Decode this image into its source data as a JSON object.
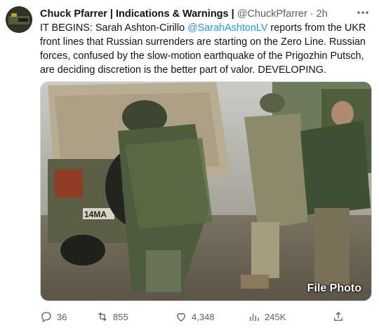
{
  "tweet": {
    "display_name": "Chuck Pfarrer | Indications & Warnings |",
    "handle": "@ChuckPfarrer",
    "separator": "·",
    "time": "2h",
    "text_prefix": "IT BEGINS: Sarah Ashton-Cirillo ",
    "mention": "@SarahAshtonLV",
    "text_suffix": " reports from the UKR front lines that Russian surrenders are starting on the Zero Line. Russian forces, confused by the slow-motion earthquake of the Prigozhin Putsch, are deciding discretion is the better part of valor.  DEVELOPING.",
    "media_caption": "File Photo",
    "vehicle_plate": "14МА"
  },
  "actions": {
    "replies": "36",
    "retweets": "855",
    "likes": "4,348",
    "views": "245K"
  },
  "icons": [
    "avatar",
    "more-icon",
    "reply-icon",
    "retweet-icon",
    "like-icon",
    "views-icon",
    "share-icon"
  ],
  "colors": {
    "link": "#1d9bf0",
    "secondary": "#536471",
    "text": "#0f1419"
  }
}
